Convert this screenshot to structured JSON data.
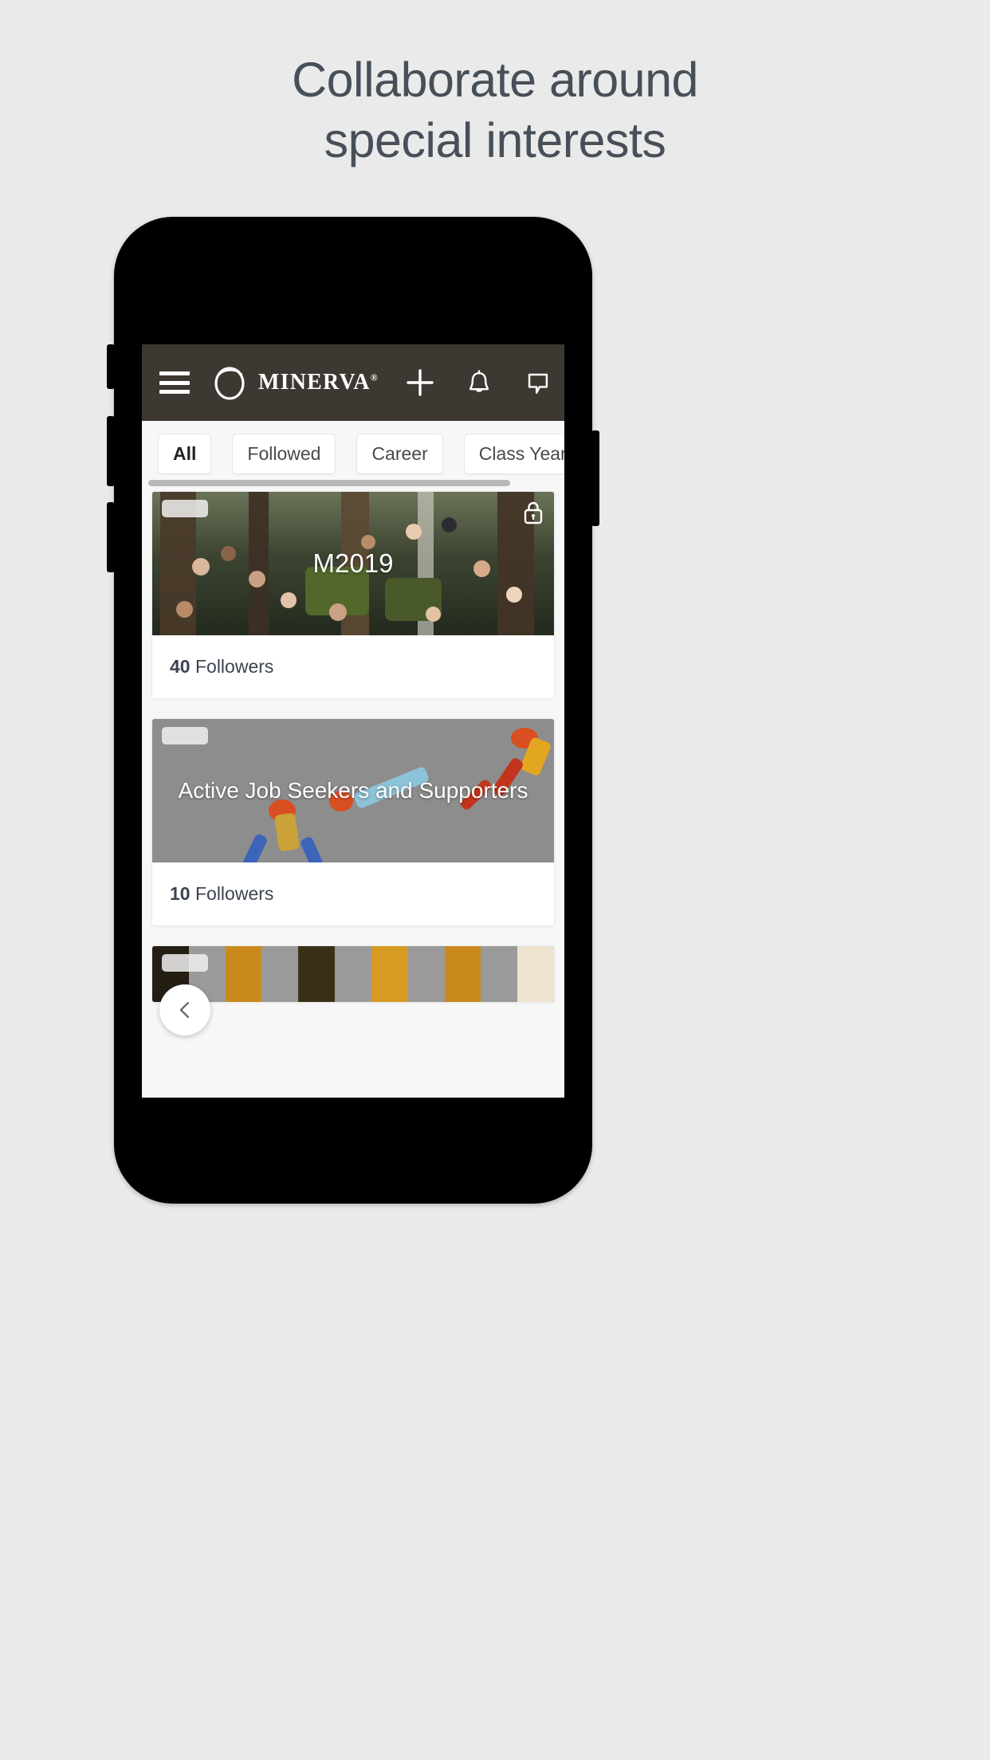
{
  "page": {
    "background_color": "#eaeaea",
    "headline_line1": "Collaborate around",
    "headline_line2": "special interests",
    "headline_color": "#474f59"
  },
  "appbar": {
    "background_color": "#3d3832",
    "menu_label": "Menu",
    "brand_name": "MINERVA",
    "brand_trademark": "®",
    "add_label": "Add",
    "notifications_label": "Notifications",
    "messages_label": "Messages",
    "avatar_label": "Profile"
  },
  "filters": {
    "items": [
      {
        "label": "All",
        "active": true
      },
      {
        "label": "Followed",
        "active": false
      },
      {
        "label": "Career",
        "active": false
      },
      {
        "label": "Class Year",
        "active": false
      }
    ]
  },
  "feed": {
    "followers_suffix": "Followers",
    "cards": [
      {
        "title": "M2019",
        "followers_count": "40",
        "followers_suffix": "Followers",
        "private": true,
        "badge": true,
        "media_kind": "forest-photo"
      },
      {
        "title": "Active Job Seekers and Supporters",
        "followers_count": "10",
        "followers_suffix": "Followers",
        "private": false,
        "badge": true,
        "media_kind": "illustration",
        "media_background": "#8d8d8d"
      },
      {
        "title": "",
        "followers_count": "",
        "followers_suffix": "",
        "private": false,
        "badge": true,
        "media_kind": "batik-pattern"
      }
    ]
  },
  "fab": {
    "back_label": "Back"
  }
}
